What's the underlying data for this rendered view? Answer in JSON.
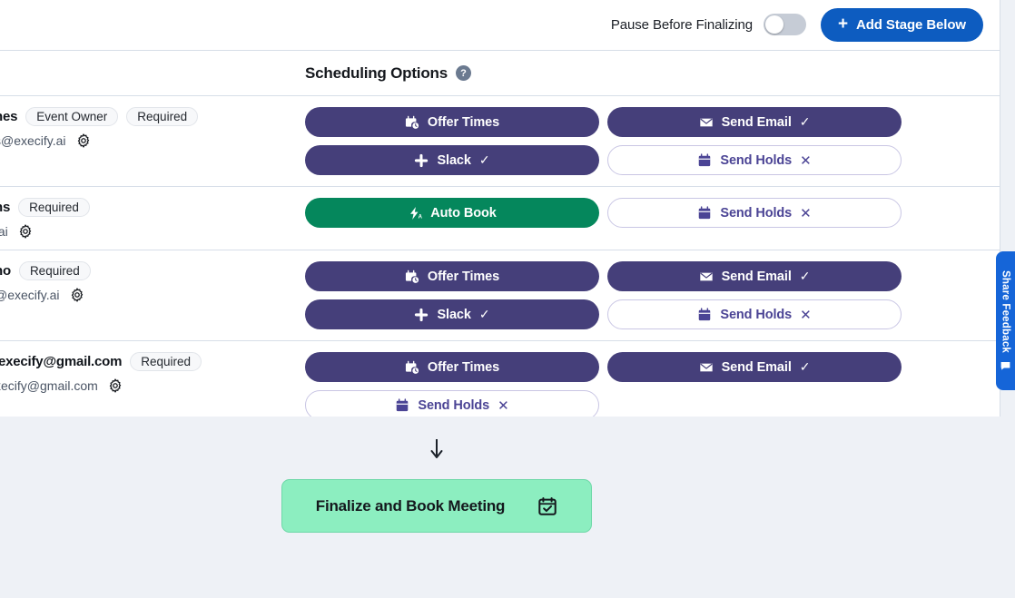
{
  "header": {
    "pause_label": "Pause Before Finalizing",
    "pause_toggle_state": "off",
    "add_stage_label": "Add Stage Below",
    "add_stage_plus": "+",
    "accent_blue": "#0d5cc0"
  },
  "scheduling_options": {
    "title": "Scheduling Options",
    "help_glyph": "?"
  },
  "colors": {
    "purple": "#453f7a",
    "green": "#05875c",
    "outline_text": "#4b4495",
    "finalize_bg": "#8ceec0",
    "page_bg": "#eef1f6"
  },
  "attendees": [
    {
      "name": "hes",
      "tags": [
        "Event Owner",
        "Required"
      ],
      "email": "s@execify.ai",
      "actions_left": [
        {
          "label": "Offer Times",
          "icon": "calendar-clock-icon",
          "style": "purple",
          "state": ""
        },
        {
          "label": "Slack",
          "icon": "slack-icon",
          "style": "purple",
          "state": "selected",
          "state_glyph": "✓"
        }
      ],
      "actions_right": [
        {
          "label": "Send Email",
          "icon": "envelope-icon",
          "style": "purple",
          "state": "selected",
          "state_glyph": "✓"
        },
        {
          "label": "Send Holds",
          "icon": "calendar-icon",
          "style": "outline",
          "state": "unselected",
          "state_glyph": "✕"
        }
      ]
    },
    {
      "name": "ns",
      "tags": [
        "Required"
      ],
      "email": ".ai",
      "actions_left": [
        {
          "label": "Auto Book",
          "icon": "auto-book-bolt-icon",
          "style": "green",
          "state": ""
        }
      ],
      "actions_right": [
        {
          "label": "Send Holds",
          "icon": "calendar-icon",
          "style": "outline",
          "state": "unselected",
          "state_glyph": "✕"
        }
      ]
    },
    {
      "name": "no",
      "tags": [
        "Required"
      ],
      "email": "@execify.ai",
      "actions_left": [
        {
          "label": "Offer Times",
          "icon": "calendar-clock-icon",
          "style": "purple",
          "state": ""
        },
        {
          "label": "Slack",
          "icon": "slack-icon",
          "style": "purple",
          "state": "selected",
          "state_glyph": "✓"
        }
      ],
      "actions_right": [
        {
          "label": "Send Email",
          "icon": "envelope-icon",
          "style": "purple",
          "state": "selected",
          "state_glyph": "✓"
        },
        {
          "label": "Send Holds",
          "icon": "calendar-icon",
          "style": "outline",
          "state": "unselected",
          "state_glyph": "✕"
        }
      ]
    },
    {
      "name": ".execify@gmail.com",
      "tags": [
        "Required"
      ],
      "email": "xecify@gmail.com",
      "actions_left": [
        {
          "label": "Offer Times",
          "icon": "calendar-clock-icon",
          "style": "purple",
          "state": ""
        },
        {
          "label": "Send Holds",
          "icon": "calendar-icon",
          "style": "outline",
          "state": "unselected",
          "state_glyph": "✕"
        }
      ],
      "actions_right": [
        {
          "label": "Send Email",
          "icon": "envelope-icon",
          "style": "purple",
          "state": "selected",
          "state_glyph": "✓"
        }
      ]
    }
  ],
  "footer": {
    "arrow_icon": "down-arrow-icon",
    "finalize_label": "Finalize and Book Meeting",
    "finalize_icon": "calendar-check-icon"
  },
  "feedback_tab": {
    "label": "Share Feedback",
    "icon": "speech-bubble-icon"
  }
}
